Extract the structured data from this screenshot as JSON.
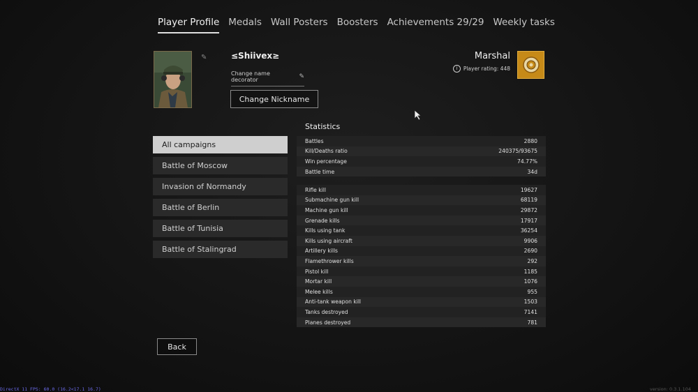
{
  "tabs": [
    {
      "label": "Player Profile",
      "active": true
    },
    {
      "label": "Medals"
    },
    {
      "label": "Wall Posters"
    },
    {
      "label": "Boosters"
    },
    {
      "label": "Achievements 29/29"
    },
    {
      "label": "Weekly tasks"
    }
  ],
  "profile": {
    "nickname": "≤Shiivex≥",
    "change_decorator_label": "Change name decorator",
    "change_nickname_label": "Change Nickname",
    "rank": "Marshal",
    "rating_label": "Player rating: 448"
  },
  "statistics_title": "Statistics",
  "campaigns": [
    {
      "label": "All campaigns",
      "active": true
    },
    {
      "label": "Battle of Moscow"
    },
    {
      "label": "Invasion of Normandy"
    },
    {
      "label": "Battle of Berlin"
    },
    {
      "label": "Battle of Tunisia"
    },
    {
      "label": "Battle of Stalingrad"
    }
  ],
  "summary_stats": [
    {
      "label": "Battles",
      "value": "2880"
    },
    {
      "label": "Kill/Deaths ratio",
      "value": "240375/93675"
    },
    {
      "label": "Win percentage",
      "value": "74.77%"
    },
    {
      "label": "Battle time",
      "value": "34d"
    }
  ],
  "kill_stats": [
    {
      "label": "Rifle kill",
      "value": "19627"
    },
    {
      "label": "Submachine gun kill",
      "value": "68119"
    },
    {
      "label": "Machine gun kill",
      "value": "29872"
    },
    {
      "label": "Grenade kills",
      "value": "17917"
    },
    {
      "label": "Kills using tank",
      "value": "36254"
    },
    {
      "label": "Kills using aircraft",
      "value": "9906"
    },
    {
      "label": "Artillery kills",
      "value": "2690"
    },
    {
      "label": "Flamethrower kills",
      "value": "292"
    },
    {
      "label": "Pistol kill",
      "value": "1185"
    },
    {
      "label": "Mortar kill",
      "value": "1076"
    },
    {
      "label": "Melee kills",
      "value": "955"
    },
    {
      "label": "Anti-tank weapon kill",
      "value": "1503"
    },
    {
      "label": "Tanks destroyed",
      "value": "7141"
    },
    {
      "label": "Planes destroyed",
      "value": "781"
    }
  ],
  "back_label": "Back",
  "fps_text": "DirectX 11 FPS: 60.0 (16.2<17.1 16.7)",
  "version_text": "version: 0.3.1.104",
  "colors": {
    "rank_badge": "#c68a18",
    "active_campaign": "#cfcfcf",
    "fps_text": "#6a6ae8"
  },
  "icons": [
    "pencil-icon",
    "info-icon",
    "rank-badge-icon",
    "cursor-icon",
    "edit-corner-icon"
  ]
}
